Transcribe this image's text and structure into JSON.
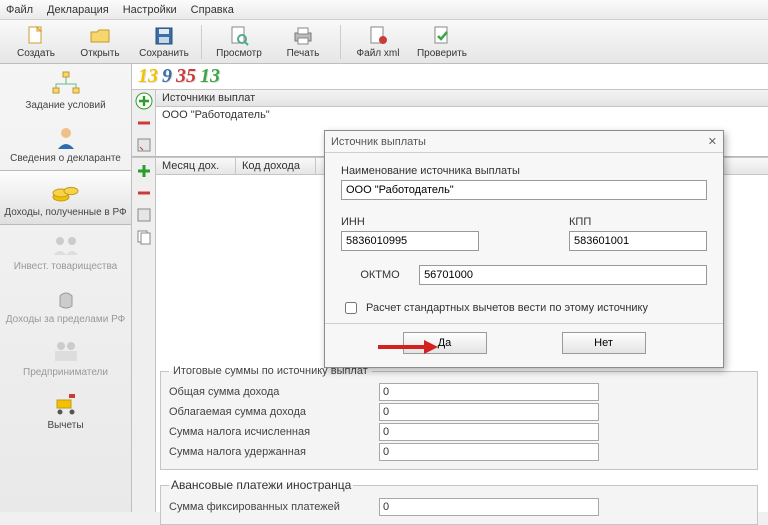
{
  "menu": {
    "file": "Файл",
    "decl": "Декларация",
    "settings": "Настройки",
    "help": "Справка"
  },
  "toolbar": {
    "new": "Создать",
    "open": "Открыть",
    "save": "Сохранить",
    "preview": "Просмотр",
    "print": "Печать",
    "xml": "Файл xml",
    "check": "Проверить"
  },
  "bignum": [
    "13",
    "9",
    "35",
    "13"
  ],
  "sidebar": {
    "conditions": "Задание условий",
    "declarant": "Сведения о декларанте",
    "income_rf": "Доходы, полученные в РФ",
    "invest": "Инвест. товарищества",
    "foreign": "Доходы за пределами РФ",
    "entrep": "Предприниматели",
    "deductions": "Вычеты"
  },
  "sources": {
    "header": "Источники выплат",
    "item": "ООО \"Работодатель\""
  },
  "table": {
    "month": "Месяц дох.",
    "code": "Код дохода"
  },
  "dialog": {
    "title": "Источник выплаты",
    "name_label": "Наименование источника выплаты",
    "name_value": "ООО \"Работодатель\"",
    "inn_label": "ИНН",
    "inn_value": "5836010995",
    "kpp_label": "КПП",
    "kpp_value": "583601001",
    "oktmo_label": "ОКТМО",
    "oktmo_value": "56701000",
    "checkbox": "Расчет стандартных вычетов вести по этому источнику",
    "yes": "Да",
    "no": "Нет"
  },
  "totals": {
    "legend": "Итоговые суммы по источнику выплат",
    "total_income": "Общая сумма дохода",
    "taxable_income": "Облагаемая сумма дохода",
    "tax_calc": "Сумма налога исчисленная",
    "tax_withheld": "Сумма налога удержанная",
    "zero": "0"
  },
  "advance": {
    "legend": "Авансовые платежи иностранца",
    "fixed": "Сумма фиксированных платежей"
  }
}
